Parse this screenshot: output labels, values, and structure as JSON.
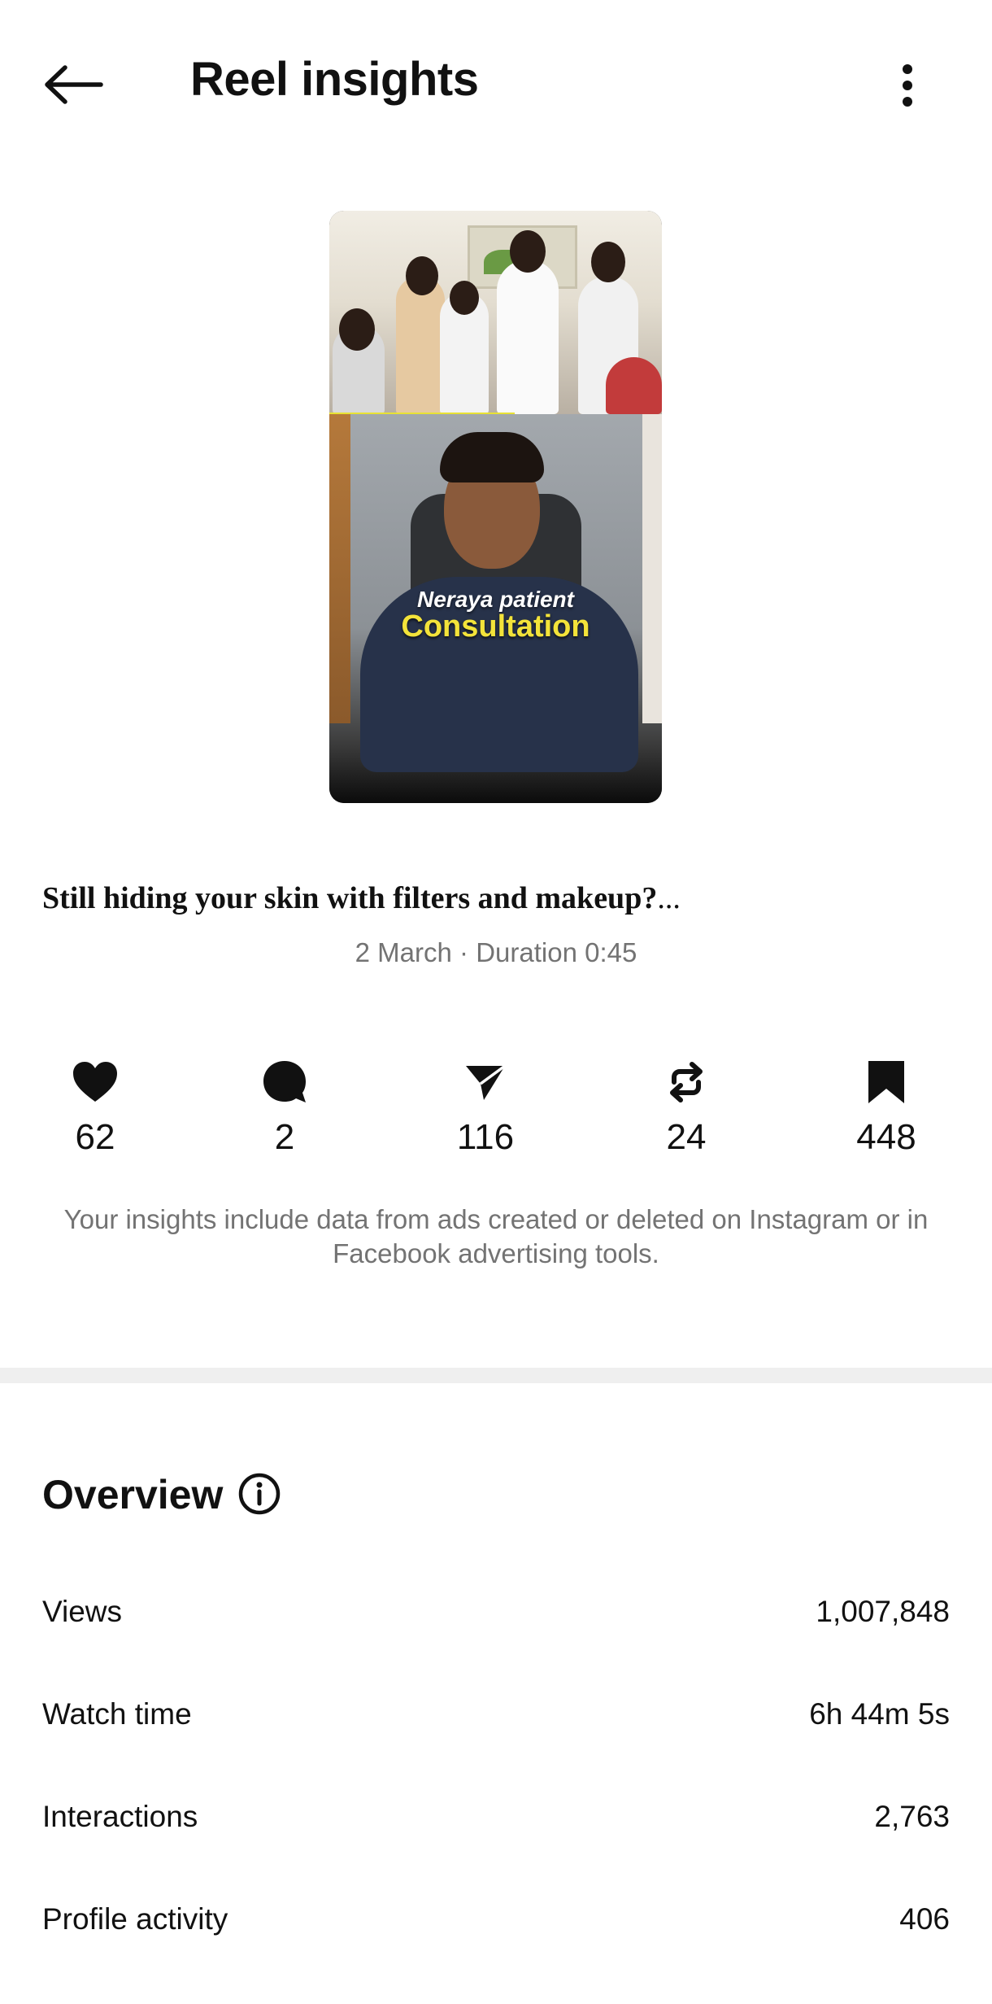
{
  "header": {
    "back_icon": "arrow-left-icon",
    "title": "Reel insights",
    "more_icon": "more-vertical-icon"
  },
  "thumbnail": {
    "caption_line1": "Neraya patient",
    "caption_line2": "Consultation"
  },
  "post": {
    "title": "Still hiding your skin with filters and makeup?",
    "title_ellipsis": "...",
    "meta": "2 March · Duration 0:45"
  },
  "stats": [
    {
      "icon": "heart-icon",
      "value": "62"
    },
    {
      "icon": "comment-icon",
      "value": "2"
    },
    {
      "icon": "share-icon",
      "value": "116"
    },
    {
      "icon": "repost-icon",
      "value": "24"
    },
    {
      "icon": "bookmark-icon",
      "value": "448"
    }
  ],
  "disclaimer": "Your insights include data from ads created or deleted on Instagram or in Facebook advertising tools.",
  "overview": {
    "title": "Overview",
    "info_icon": "info-icon",
    "rows": [
      {
        "label": "Views",
        "value": "1,007,848"
      },
      {
        "label": "Watch time",
        "value": "6h 44m 5s"
      },
      {
        "label": "Interactions",
        "value": "2,763"
      },
      {
        "label": "Profile activity",
        "value": "406"
      }
    ]
  },
  "colors": {
    "text": "#111111",
    "secondary_text": "#737373",
    "divider": "#efefef",
    "caption_yellow": "#f3e33a"
  }
}
